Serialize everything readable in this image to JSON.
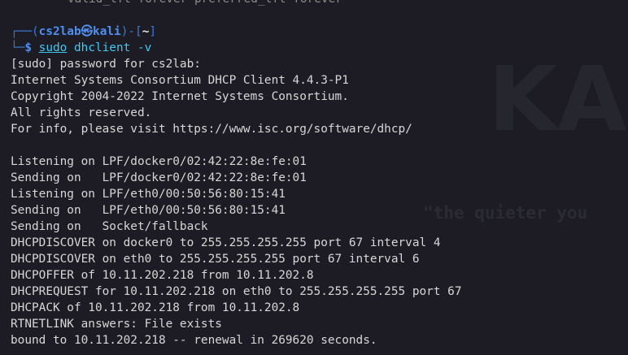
{
  "terminal": {
    "top_partial_line": "valid_lft forever preferred_lft forever",
    "prompt": {
      "open": "┌──(",
      "user": "cs2lab",
      "at": "㉿",
      "host": "kali",
      "mid": ")-[",
      "path": "~",
      "close": "]",
      "second_prefix": "└─",
      "dollar": "$",
      "command_sudo": "sudo",
      "command_rest": " dhclient -v"
    },
    "output": [
      "[sudo] password for cs2lab:",
      "Internet Systems Consortium DHCP Client 4.4.3-P1",
      "Copyright 2004-2022 Internet Systems Consortium.",
      "All rights reserved.",
      "For info, please visit https://www.isc.org/software/dhcp/",
      "",
      "Listening on LPF/docker0/02:42:22:8e:fe:01",
      "Sending on   LPF/docker0/02:42:22:8e:fe:01",
      "Listening on LPF/eth0/00:50:56:80:15:41",
      "Sending on   LPF/eth0/00:50:56:80:15:41",
      "Sending on   Socket/fallback",
      "DHCPDISCOVER on docker0 to 255.255.255.255 port 67 interval 4",
      "DHCPDISCOVER on eth0 to 255.255.255.255 port 67 interval 6",
      "DHCPOFFER of 10.11.202.218 from 10.11.202.8",
      "DHCPREQUEST for 10.11.202.218 on eth0 to 255.255.255.255 port 67",
      "DHCPACK of 10.11.202.218 from 10.11.202.8",
      "RTNETLINK answers: File exists",
      "bound to 10.11.202.218 -- renewal in 269620 seconds."
    ]
  },
  "wallpaper": {
    "tagline": "\"the quieter you",
    "logo_text": "KAL"
  },
  "colors": {
    "background": "#1d1c24",
    "text": "#d7d7d7",
    "prompt_blue": "#4f8ff0",
    "command_cyan": "#41c7f0"
  }
}
